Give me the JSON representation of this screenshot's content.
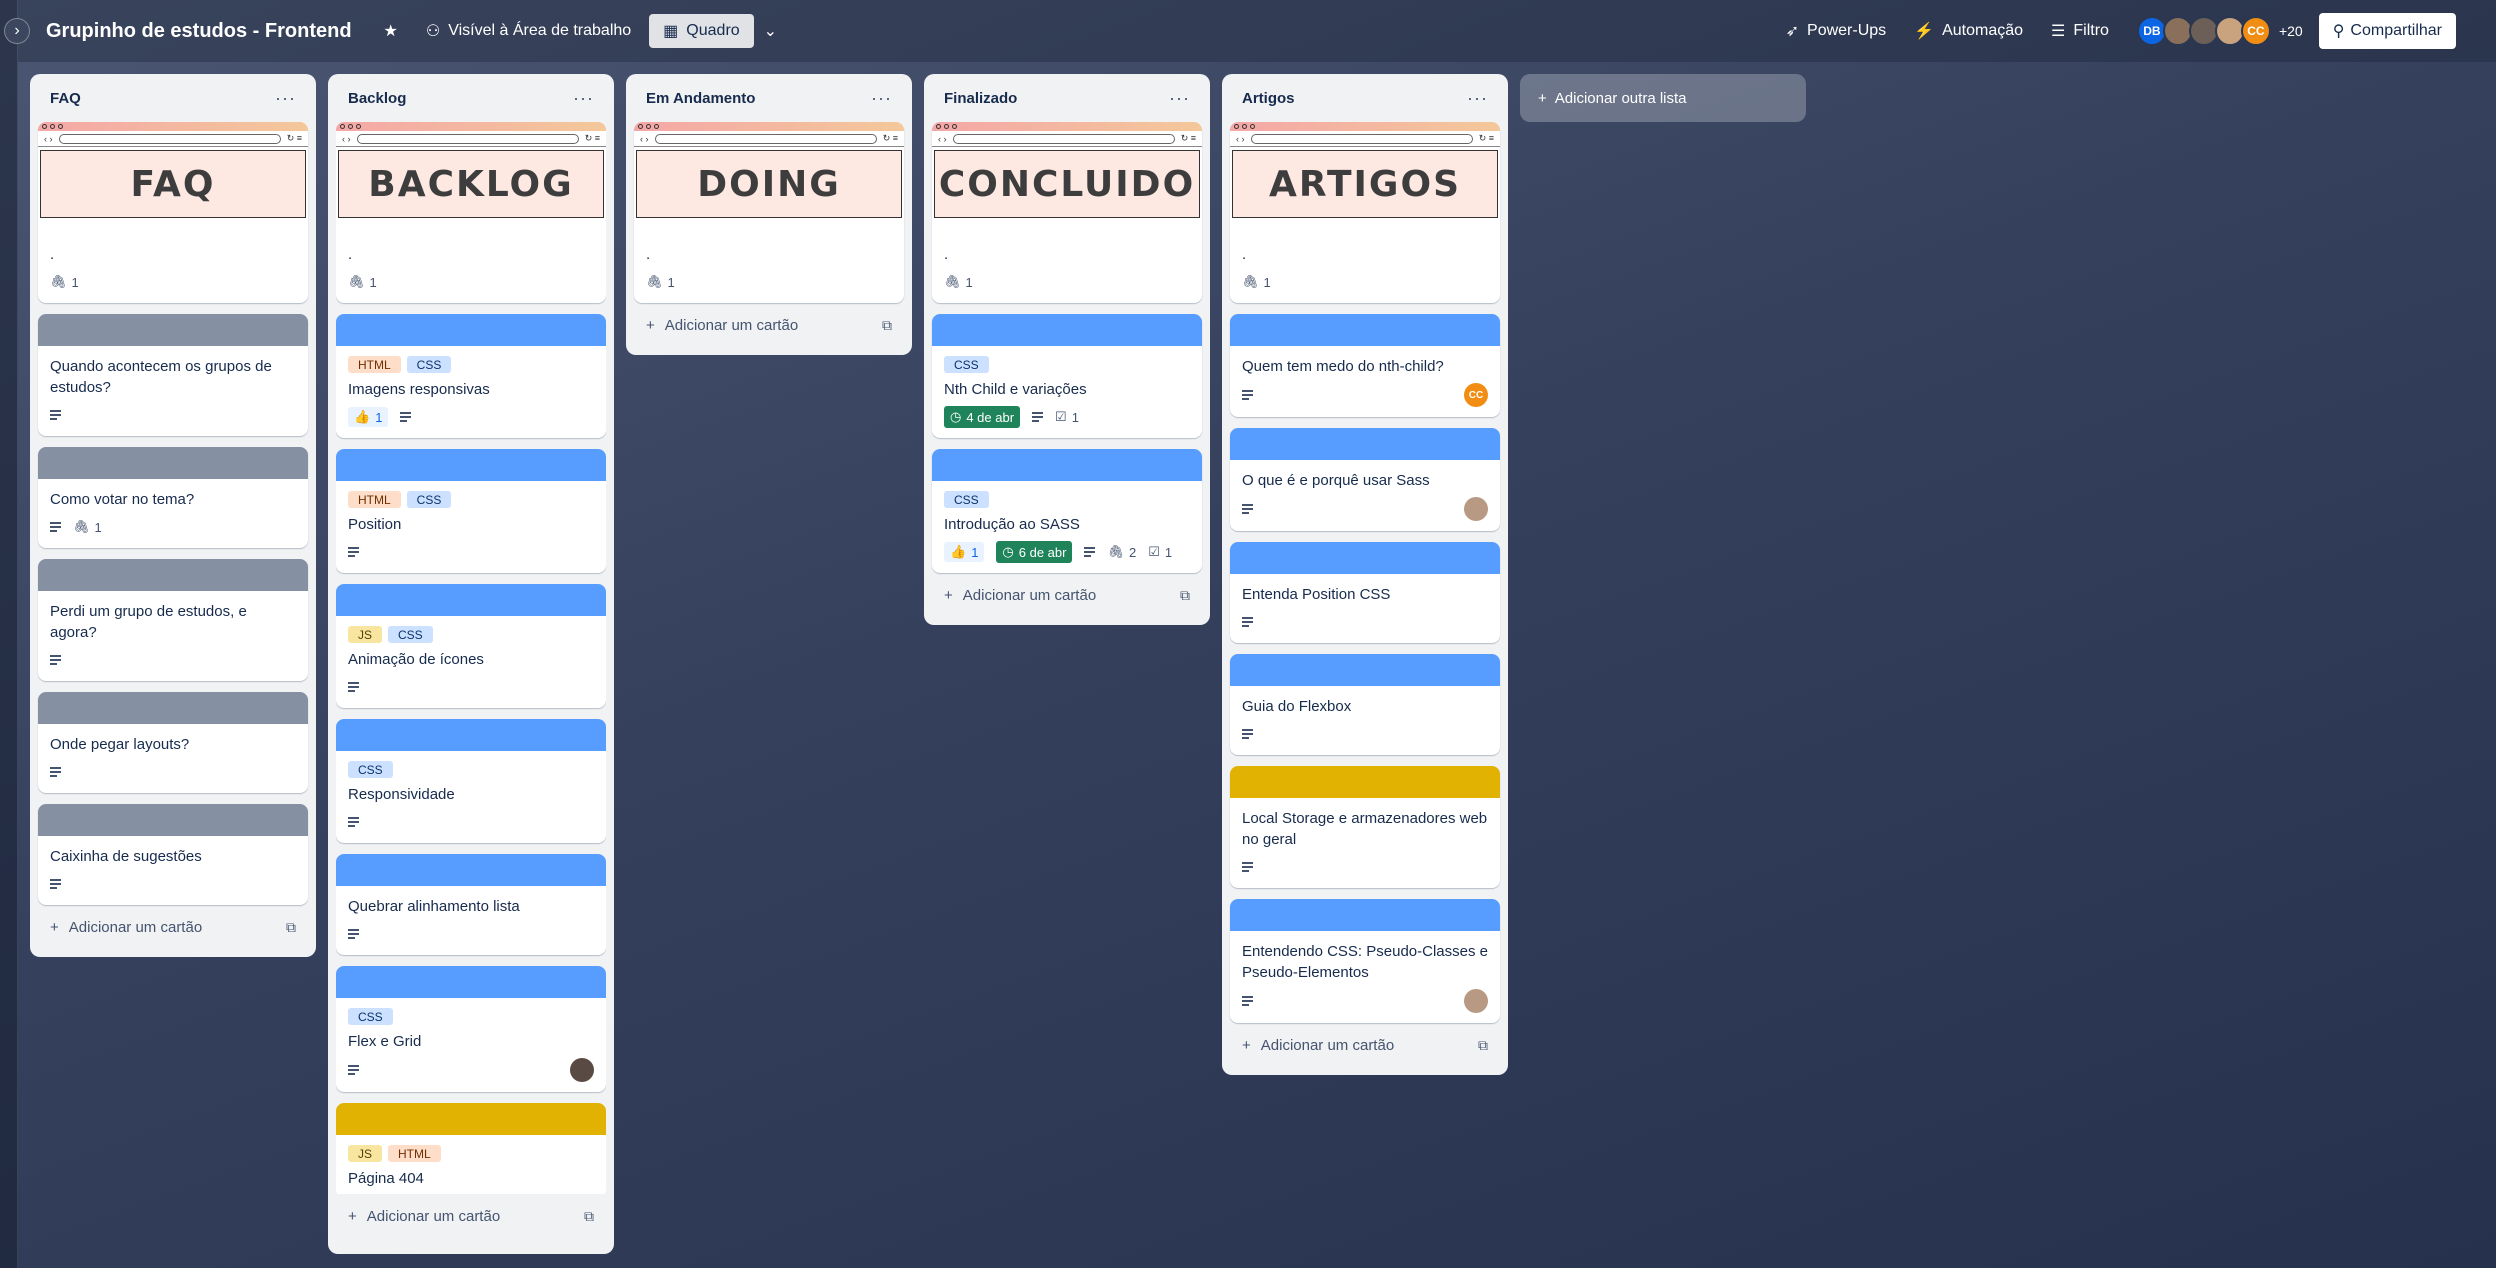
{
  "header": {
    "title": "Grupinho de estudos - Frontend",
    "visibility": "Visível à Área de trabalho",
    "view": "Quadro",
    "powerups": "Power-Ups",
    "automation": "Automação",
    "filter": "Filtro",
    "avatars": [
      {
        "initials": "DB",
        "color": "#0c66e4"
      },
      {
        "initials": "",
        "color": "#8a6f5a"
      },
      {
        "initials": "",
        "color": "#6b5f57"
      },
      {
        "initials": "",
        "color": "#c9a27e"
      },
      {
        "initials": "CC",
        "color": "#f18d13"
      }
    ],
    "more_members": "+20",
    "share": "Compartilhar"
  },
  "lists": {
    "faq": {
      "title": "FAQ",
      "cover_text": "FAQ",
      "first_card_title": ".",
      "first_card_attach": "1",
      "cards": [
        {
          "title": "Quando acontecem os grupos de estudos?"
        },
        {
          "title": "Como votar no tema?",
          "attach": "1"
        },
        {
          "title": "Perdi um grupo de estudos, e agora?"
        },
        {
          "title": "Onde pegar layouts?"
        },
        {
          "title": "Caixinha de sugestões"
        }
      ],
      "add_card": "Adicionar um cartão"
    },
    "backlog": {
      "title": "Backlog",
      "cover_text": "BACKLOG",
      "first_card_title": ".",
      "first_card_attach": "1",
      "cards": [
        {
          "title": "Imagens responsivas",
          "labels": [
            "HTML",
            "CSS"
          ],
          "votes": "1"
        },
        {
          "title": "Position",
          "labels": [
            "HTML",
            "CSS"
          ]
        },
        {
          "title": "Animação de ícones",
          "labels": [
            "JS",
            "CSS"
          ]
        },
        {
          "title": "Responsividade",
          "labels": [
            "CSS"
          ]
        },
        {
          "title": "Quebrar alinhamento lista"
        },
        {
          "title": "Flex e Grid",
          "labels": [
            "CSS"
          ]
        },
        {
          "title": "Página 404",
          "labels": [
            "JS",
            "HTML"
          ]
        }
      ],
      "add_card": "Adicionar um cartão"
    },
    "doing": {
      "title": "Em Andamento",
      "cover_text": "DOING",
      "first_card_title": ".",
      "first_card_attach": "1",
      "add_card": "Adicionar um cartão"
    },
    "done": {
      "title": "Finalizado",
      "cover_text": "CONCLUIDO",
      "first_card_title": ".",
      "first_card_attach": "1",
      "cards": [
        {
          "title": "Nth Child e variações",
          "labels": [
            "CSS"
          ],
          "due": "4 de abr",
          "checklist": "1"
        },
        {
          "title": "Introdução ao SASS",
          "labels": [
            "CSS"
          ],
          "votes": "1",
          "due": "6 de abr",
          "attach": "2",
          "checklist": "1"
        }
      ],
      "add_card": "Adicionar um cartão"
    },
    "articles": {
      "title": "Artigos",
      "cover_text": "ARTIGOS",
      "first_card_title": ".",
      "first_card_attach": "1",
      "cards": [
        {
          "title": "Quem tem medo do nth-child?",
          "member": "CC"
        },
        {
          "title": "O que é e porquê usar Sass"
        },
        {
          "title": "Entenda Position CSS"
        },
        {
          "title": "Guia do Flexbox"
        },
        {
          "title": "Local Storage e armazenadores web no geral"
        },
        {
          "title": "Entendendo CSS: Pseudo-Classes e Pseudo-Elementos"
        }
      ],
      "add_card": "Adicionar um cartão"
    }
  },
  "add_list": "Adicionar outra lista",
  "colors": {
    "label_html": "#fedec8",
    "label_css": "#cce0ff",
    "label_js": "#f8e6a0",
    "cover_blue": "#579dff",
    "cover_gray": "#8590a2",
    "cover_yellow": "#e2b203",
    "due_green": "#1f845a"
  }
}
